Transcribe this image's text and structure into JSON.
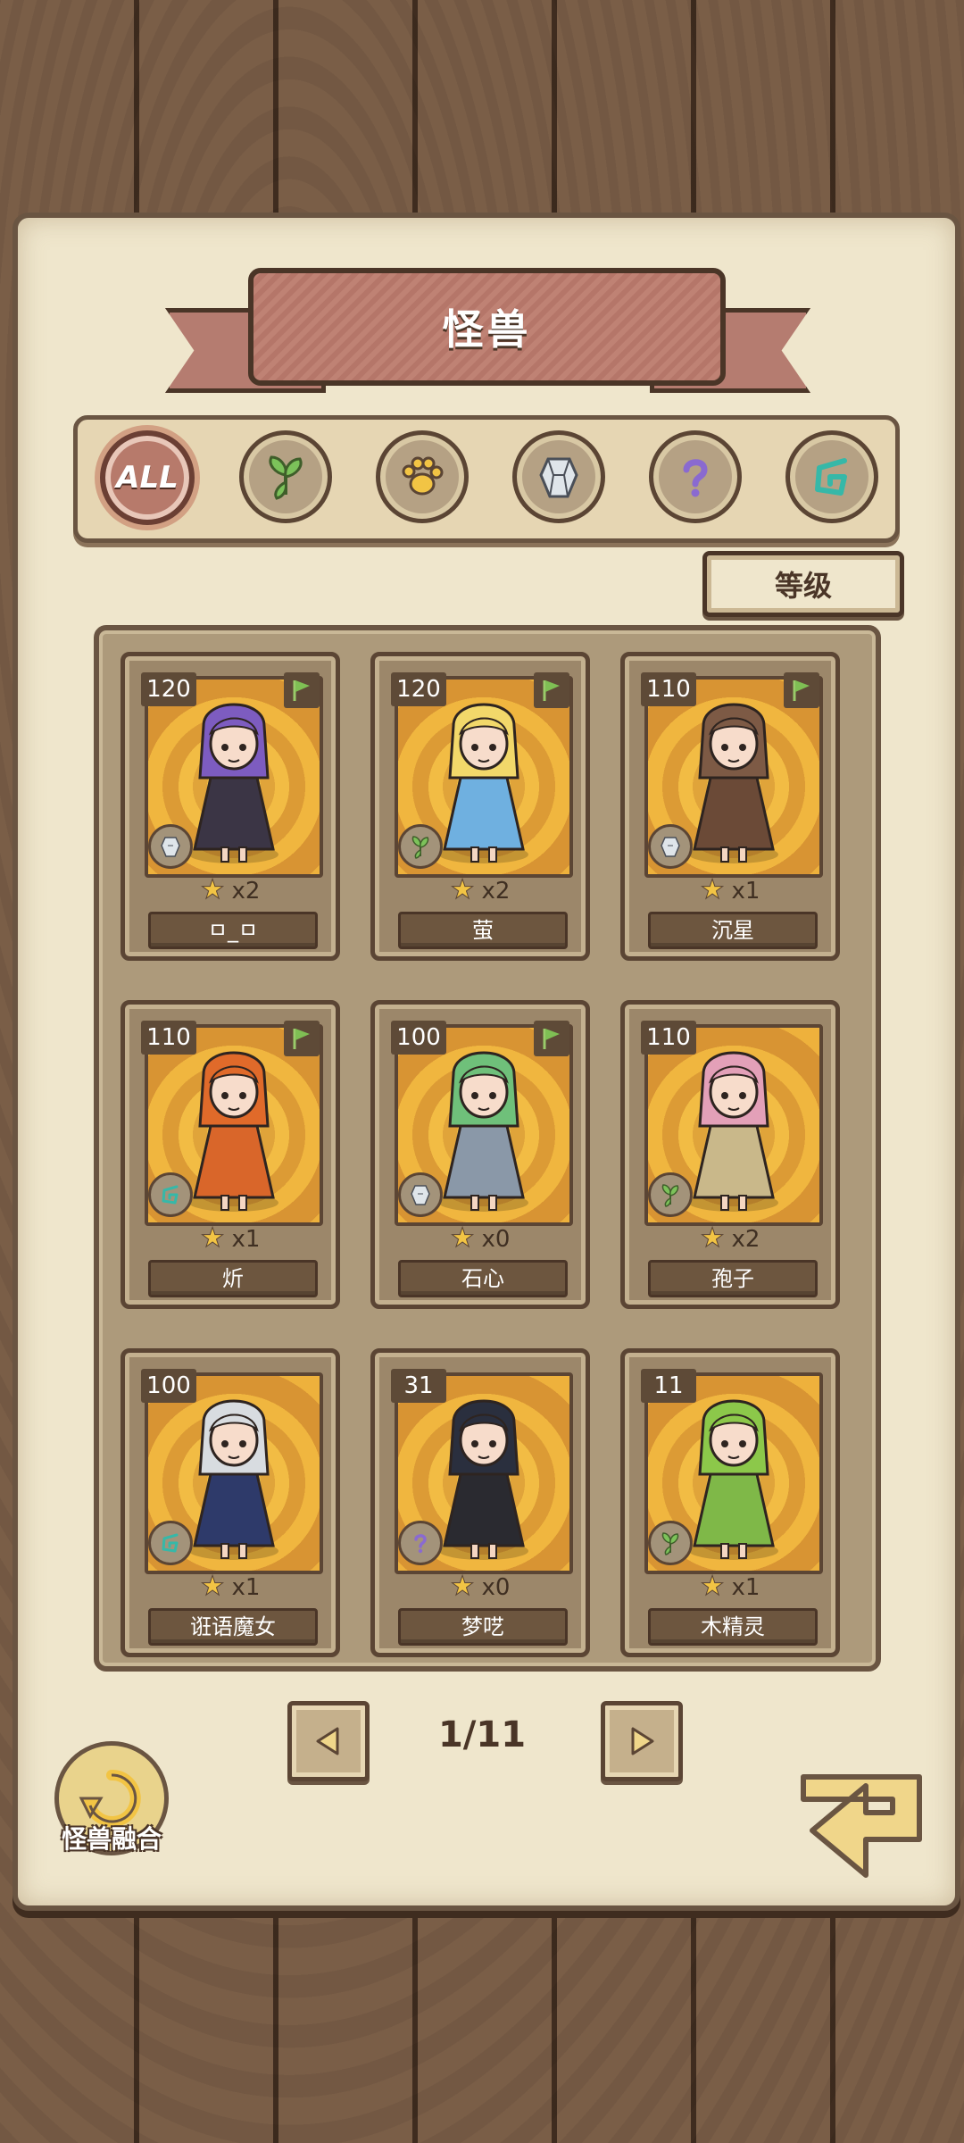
{
  "title": "怪兽",
  "filters": [
    {
      "id": "all",
      "label": "ALL",
      "icon": "all-label",
      "active": true
    },
    {
      "id": "plant",
      "icon": "leaf-icon"
    },
    {
      "id": "beast",
      "icon": "paw-icon"
    },
    {
      "id": "mineral",
      "icon": "crystal-icon"
    },
    {
      "id": "mystery",
      "icon": "question-icon"
    },
    {
      "id": "arcane",
      "icon": "rune-icon"
    }
  ],
  "sort_label": "等级",
  "cards": [
    {
      "level": "120",
      "count": "x2",
      "name": "ㅁ_ㅁ",
      "type": "crystal-icon",
      "flag": true,
      "hair": "#7d5cc0",
      "dress": "#3b3545"
    },
    {
      "level": "120",
      "count": "x2",
      "name": "萤",
      "type": "leaf-icon",
      "flag": true,
      "hair": "#f2d86a",
      "dress": "#6fb0e0"
    },
    {
      "level": "110",
      "count": "x1",
      "name": "沉星",
      "type": "crystal-icon",
      "flag": true,
      "hair": "#7d5a45",
      "dress": "#6b4a37"
    },
    {
      "level": "110",
      "count": "x1",
      "name": "炘",
      "type": "rune-icon",
      "flag": true,
      "hair": "#e06a2a",
      "dress": "#d9662a"
    },
    {
      "level": "100",
      "count": "x0",
      "name": "石心",
      "type": "crystal-icon",
      "flag": true,
      "hair": "#6fc07a",
      "dress": "#8a98a8"
    },
    {
      "level": "110",
      "count": "x2",
      "name": "孢子",
      "type": "leaf-icon",
      "flag": false,
      "hair": "#e3a0b8",
      "dress": "#c9b88a"
    },
    {
      "level": "100",
      "count": "x1",
      "name": "诳语魔女",
      "type": "rune-icon",
      "flag": false,
      "hair": "#d8dce0",
      "dress": "#2e3a6a"
    },
    {
      "level": "31",
      "count": "x0",
      "name": "梦呓",
      "type": "question-icon",
      "flag": false,
      "hair": "#2a2f3e",
      "dress": "#2a2a30"
    },
    {
      "level": "11",
      "count": "x1",
      "name": "木精灵",
      "type": "leaf-icon",
      "flag": false,
      "hair": "#8cc84a",
      "dress": "#7fb848"
    }
  ],
  "page_indicator": "1/11",
  "fusion_label": "怪兽融合",
  "colors": {
    "accent": "#b77a6b",
    "wood": "#7a5e47",
    "paper": "#efe6cc"
  }
}
